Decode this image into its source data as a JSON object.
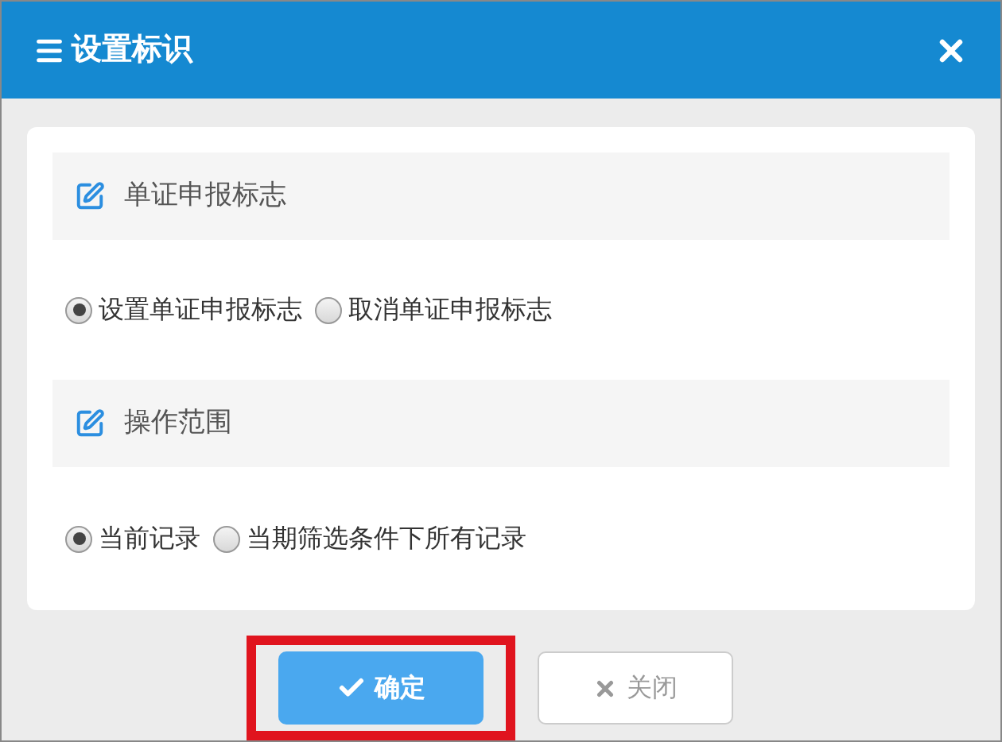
{
  "window": {
    "title": "设置标识"
  },
  "sections": [
    {
      "title": "单证申报标志",
      "options": [
        {
          "label": "设置单证申报标志",
          "selected": true
        },
        {
          "label": "取消单证申报标志",
          "selected": false
        }
      ]
    },
    {
      "title": "操作范围",
      "options": [
        {
          "label": "当前记录",
          "selected": true
        },
        {
          "label": "当期筛选条件下所有记录",
          "selected": false
        }
      ]
    }
  ],
  "buttons": [
    {
      "kind": "primary",
      "label": "确定",
      "highlighted": true
    },
    {
      "kind": "secondary",
      "label": "关闭",
      "highlighted": false
    }
  ]
}
